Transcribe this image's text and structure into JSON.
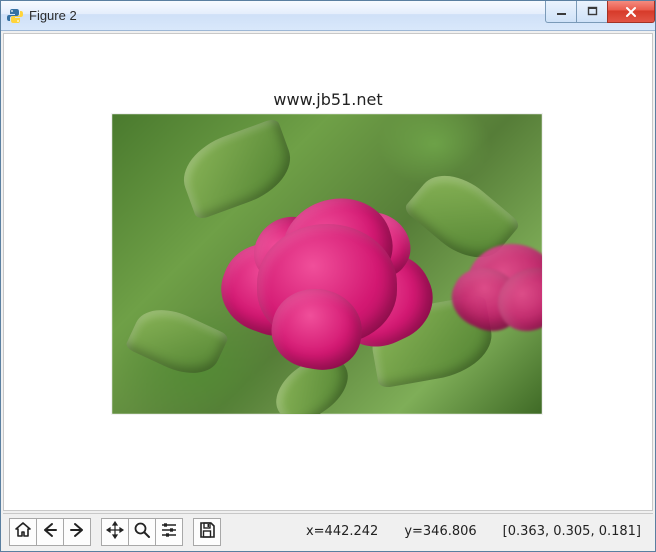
{
  "window": {
    "title": "Figure 2"
  },
  "plot": {
    "title": "www.jb51.net"
  },
  "toolbar": {
    "home": "Home",
    "back": "Back",
    "forward": "Forward",
    "pan": "Pan",
    "zoom": "Zoom",
    "configure": "Configure subplots",
    "save": "Save"
  },
  "status": {
    "x_label": "x=",
    "x_value": "442.242",
    "y_label": "y=",
    "y_value": "346.806",
    "rgb": "[0.363, 0.305, 0.181]"
  }
}
